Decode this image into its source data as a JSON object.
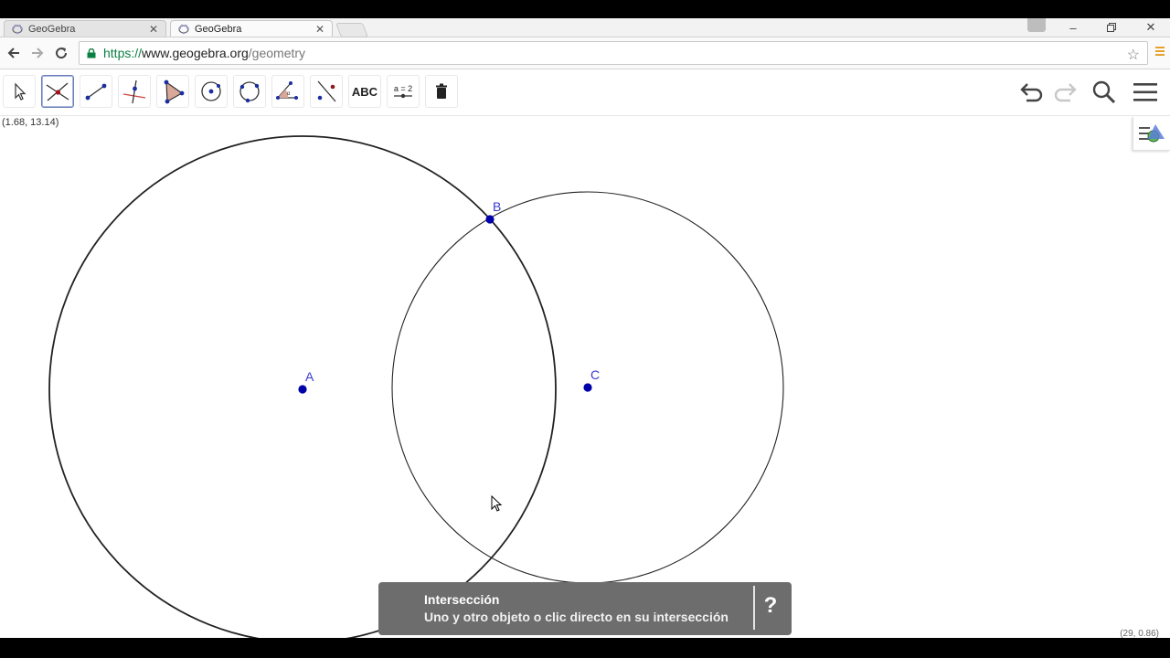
{
  "browser": {
    "tabs": [
      {
        "title": "GeoGebra",
        "active": false
      },
      {
        "title": "GeoGebra",
        "active": true
      }
    ],
    "url": {
      "scheme": "https://",
      "host": "www.geogebra.org",
      "path": "/geometry"
    },
    "window_controls": [
      "minimize",
      "restore",
      "close"
    ]
  },
  "toolbar": {
    "tools": [
      {
        "name": "move-tool",
        "icon": "arrow-cursor-icon"
      },
      {
        "name": "intersect-tool",
        "icon": "intersect-icon",
        "selected": true
      },
      {
        "name": "segment-tool",
        "icon": "segment-icon"
      },
      {
        "name": "perpendicular-line-tool",
        "icon": "perpendicular-icon"
      },
      {
        "name": "polygon-tool",
        "icon": "polygon-icon"
      },
      {
        "name": "circle-center-point-tool",
        "icon": "circle-center-icon"
      },
      {
        "name": "circle-three-points-tool",
        "icon": "circle-three-points-icon"
      },
      {
        "name": "angle-tool",
        "icon": "angle-icon"
      },
      {
        "name": "reflect-tool",
        "icon": "reflect-icon"
      },
      {
        "name": "text-tool",
        "icon": "text-icon",
        "label": "ABC"
      },
      {
        "name": "slider-tool",
        "icon": "slider-icon",
        "label": "a = 2"
      },
      {
        "name": "delete-tool",
        "icon": "trash-icon"
      }
    ],
    "right_controls": [
      "undo-icon",
      "redo-icon",
      "search-icon",
      "menu-icon"
    ]
  },
  "canvas": {
    "mouse_coords": "(1.68, 13.14)",
    "corner_coords": "(29, 0.86)",
    "points": [
      {
        "label": "A"
      },
      {
        "label": "B"
      },
      {
        "label": "C"
      }
    ],
    "colors": {
      "point": "#0000aa",
      "label": "#3a3ad0",
      "circle": "#222222"
    }
  },
  "tooltip": {
    "title": "Intersección",
    "description": "Uno y otro objeto o clic directo en su intersección",
    "help_label": "?"
  }
}
